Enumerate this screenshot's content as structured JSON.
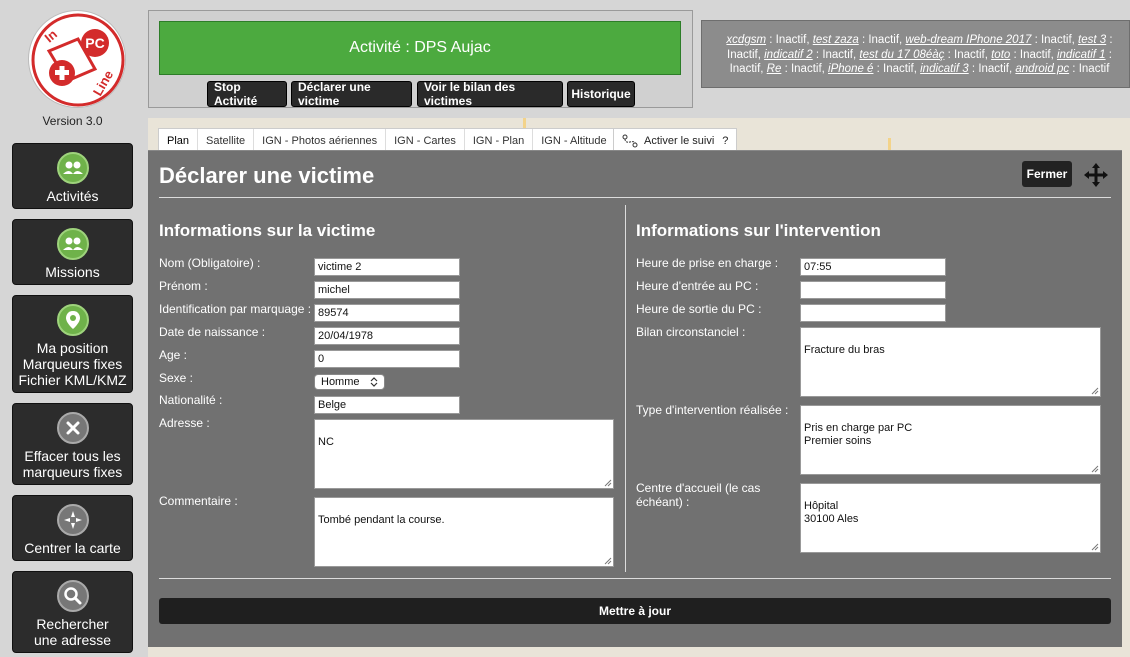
{
  "logo": {
    "text_top": "In",
    "text_pc": "PC",
    "text_line": "Line"
  },
  "version": "Version 3.0",
  "sidebar": {
    "activities": "Activités",
    "missions": "Missions",
    "position_l1": "Ma position",
    "position_l2": "Marqueurs fixes",
    "position_l3": "Fichier KML/KMZ",
    "clear_l1": "Effacer tous les",
    "clear_l2": "marqueurs fixes",
    "center": "Centrer la carte",
    "search_l1": "Rechercher",
    "search_l2": "une adresse"
  },
  "header": {
    "activity": "Activité : DPS Aujac",
    "stop": "Stop Activité",
    "declare": "Déclarer une victime",
    "bilan": "Voir le bilan des victimes",
    "history": "Historique"
  },
  "status": {
    "state": "Inactif",
    "devices": [
      "xcdgsm",
      "test zaza",
      "web-dream IPhone 2017",
      "test 3",
      "indicatif 2",
      "test du 17 08éàç",
      "toto",
      "indicatif 1",
      "Re",
      "iPhone é",
      "indicatif 3",
      "android pc"
    ]
  },
  "map": {
    "tabs": [
      "Plan",
      "Satellite",
      "IGN - Photos aériennes",
      "IGN - Cartes",
      "IGN - Plan",
      "IGN - Altitude"
    ],
    "tracking": "Activer le suivi",
    "tracking_help": "?"
  },
  "modal": {
    "title": "Déclarer une victime",
    "close": "Fermer",
    "victim_section": "Informations sur la victime",
    "intervention_section": "Informations sur l'intervention",
    "update": "Mettre à jour"
  },
  "victim": {
    "name_label": "Nom (Obligatoire) :",
    "name": "victime 2",
    "firstname_label": "Prénom :",
    "firstname": "michel",
    "marking_label": "Identification par marquage :",
    "marking": "89574",
    "birth_label": "Date de naissance :",
    "birth": "20/04/1978",
    "age_label": "Age :",
    "age": "0",
    "sex_label": "Sexe :",
    "sex": "Homme",
    "nationality_label": "Nationalité :",
    "nationality": "Belge",
    "address_label": "Adresse :",
    "address": "NC",
    "comment_label": "Commentaire :",
    "comment": "Tombé pendant la course."
  },
  "intervention": {
    "start_label": "Heure de prise en charge :",
    "start": "07:55",
    "entry_label": "Heure d'entrée au PC :",
    "entry": "",
    "exit_label": "Heure de sortie du PC :",
    "exit": "",
    "bilan_label": "Bilan circonstanciel :",
    "bilan": "Fracture du bras",
    "type_label": "Type d'intervention réalisée :",
    "type": "Pris en charge par PC\nPremier soins",
    "center_label_l1": "Centre d'accueil (le cas",
    "center_label_l2": "échéant) :",
    "center": "Hôpital\n30100 Ales"
  },
  "colors": {
    "activity_green": "#4caa3f",
    "modal_bg": "#717171",
    "button_dark": "#2a2a2a"
  }
}
